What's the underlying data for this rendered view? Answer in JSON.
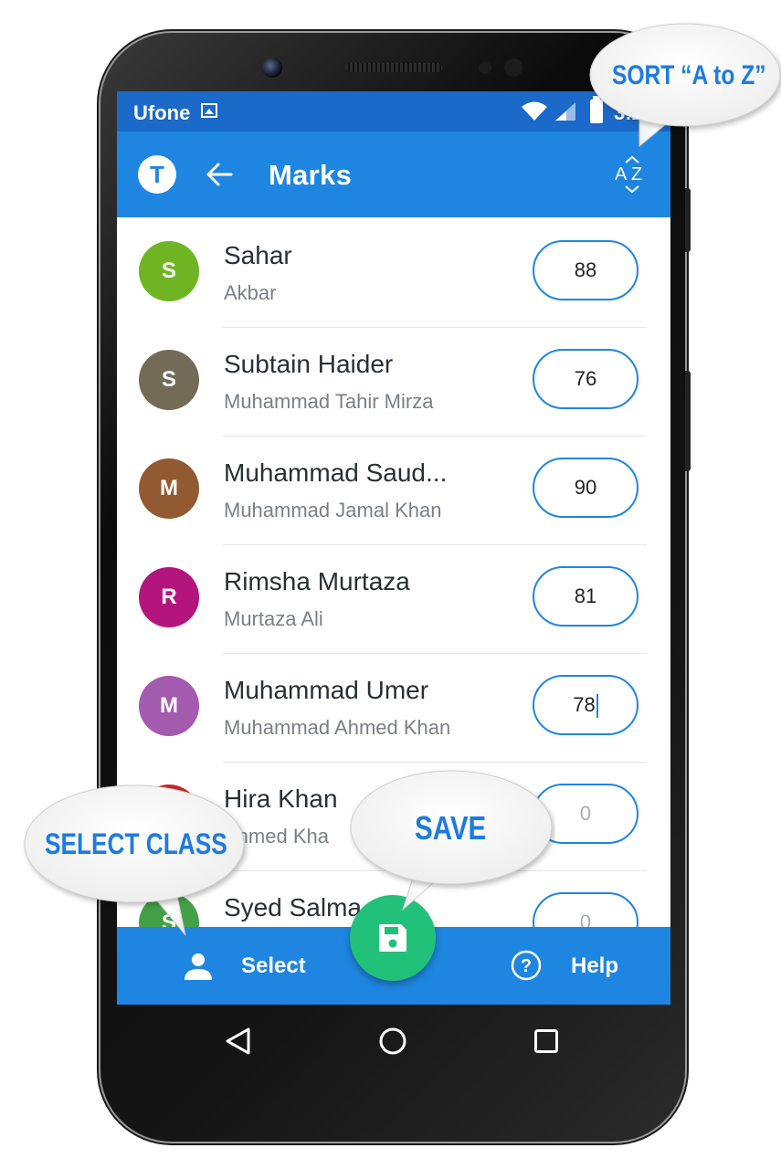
{
  "status_bar": {
    "carrier": "Ufone",
    "time": "3:2"
  },
  "app_bar": {
    "logo_letter": "T",
    "title": "Marks"
  },
  "students": [
    {
      "initial": "S",
      "name": "Sahar",
      "parent": "Akbar",
      "mark": "88",
      "color": "#6fb523"
    },
    {
      "initial": "S",
      "name": "Subtain Haider",
      "parent": "Muhammad Tahir Mirza",
      "mark": "76",
      "color": "#736b56"
    },
    {
      "initial": "M",
      "name": "Muhammad Saud...",
      "parent": "Muhammad Jamal Khan",
      "mark": "90",
      "color": "#925a30"
    },
    {
      "initial": "R",
      "name": "Rimsha Murtaza",
      "parent": "Murtaza Ali",
      "mark": "81",
      "color": "#b3157c"
    },
    {
      "initial": "M",
      "name": "Muhammad Umer",
      "parent": "Muhammad Ahmed Khan",
      "mark": "78",
      "color": "#a35bb0"
    },
    {
      "initial": "",
      "name": "Hira Khan",
      "parent": "Ahmed Kha",
      "mark": "0",
      "color": "#c62828"
    },
    {
      "initial": "S",
      "name": "Syed Salma",
      "parent": "",
      "mark": "0",
      "color": "#43a047"
    }
  ],
  "bottom_bar": {
    "select_label": "Select",
    "help_label": "Help"
  },
  "callouts": {
    "sort": "SORT “A to Z”",
    "select_class": "SELECT CLASS",
    "save": "SAVE"
  },
  "colors": {
    "status_bar": "#1b69c9",
    "app_bar": "#1e86e0",
    "fab": "#21c17a",
    "callout_text": "#1e7be0"
  }
}
